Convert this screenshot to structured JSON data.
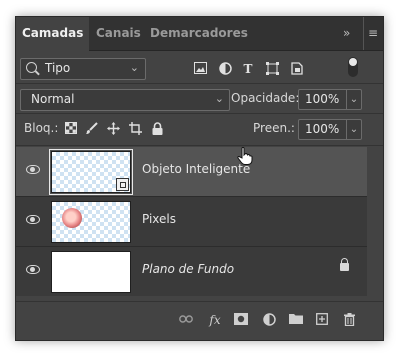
{
  "tabs": [
    "Camadas",
    "Canais",
    "Demarcadores"
  ],
  "tab_menu": {
    "collapse": "»",
    "menu": "≡"
  },
  "filter": {
    "value": "Tipo",
    "chevron": "⌄"
  },
  "filter_icons": [
    "image-filter-icon",
    "adjustment-filter-icon",
    "type-filter-icon",
    "shape-filter-icon",
    "smart-object-filter-icon"
  ],
  "filter_glyphs": {
    "type": "T"
  },
  "blend": {
    "mode": "Normal",
    "opacity_label": "Opacidade:",
    "opacity": "100%"
  },
  "lock": {
    "label": "Bloq.:",
    "fill_label": "Preen.:",
    "fill": "100%"
  },
  "layers": [
    {
      "name": "Objeto Inteligente",
      "selected": true,
      "type": "smart-object",
      "italic": false,
      "locked": false
    },
    {
      "name": "Pixels",
      "selected": false,
      "type": "pixel",
      "italic": false,
      "locked": false
    },
    {
      "name": "Plano de Fundo",
      "selected": false,
      "type": "background",
      "italic": true,
      "locked": true
    }
  ],
  "footer": {
    "fx_label": "fx"
  },
  "colors": {
    "panel_bg": "#434343",
    "tabbar_bg": "#323232",
    "selected_row": "#545454",
    "text": "#e6e6e6"
  }
}
